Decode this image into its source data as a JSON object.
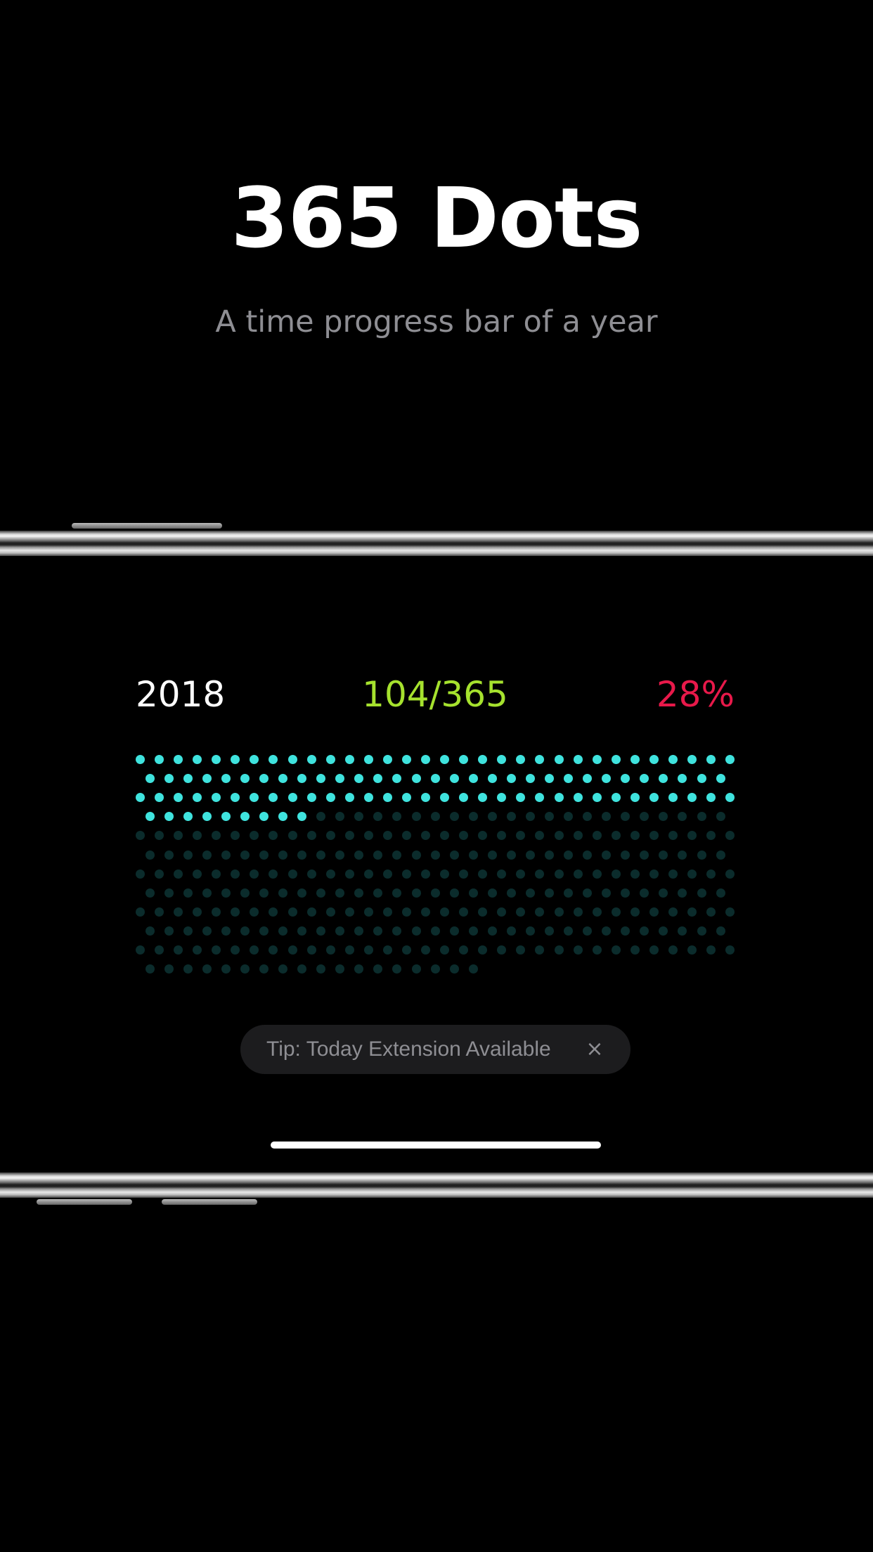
{
  "hero": {
    "title": "365 Dots",
    "subtitle": "A time progress bar of a year"
  },
  "stats": {
    "year": "2018",
    "count": "104/365",
    "percent": "28%"
  },
  "progress": {
    "days_elapsed": 104,
    "days_total": 365,
    "fraction": 0.2849
  },
  "tip": {
    "text": "Tip: Today Extension Available",
    "close_glyph": "×"
  },
  "icons": {
    "close": "close-icon"
  },
  "colors": {
    "background": "#000000",
    "title": "#ffffff",
    "subtitle": "#8e8e93",
    "year": "#ffffff",
    "count": "#a6e22e",
    "percent": "#e8194a",
    "dot_active": "#3fe3de",
    "dot_inactive": "#0b2c2c",
    "tip_bg": "#1c1c1e"
  }
}
